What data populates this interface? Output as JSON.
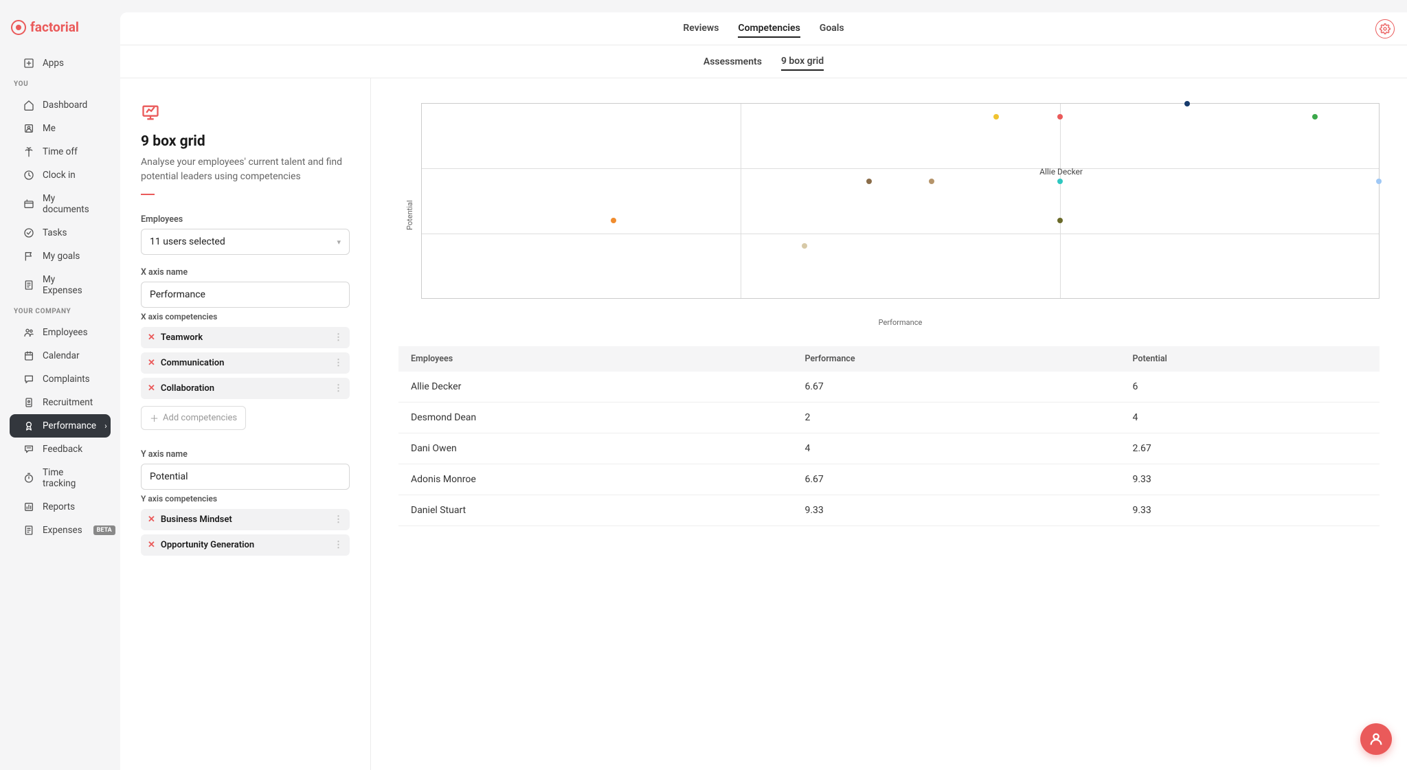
{
  "brand": "factorial",
  "sidebar": {
    "apps": "Apps",
    "you_hdr": "YOU",
    "company_hdr": "YOUR COMPANY",
    "you": [
      {
        "label": "Dashboard",
        "icon": "home"
      },
      {
        "label": "Me",
        "icon": "user"
      },
      {
        "label": "Time off",
        "icon": "palm"
      },
      {
        "label": "Clock in",
        "icon": "clock"
      },
      {
        "label": "My documents",
        "icon": "folder"
      },
      {
        "label": "Tasks",
        "icon": "check"
      },
      {
        "label": "My goals",
        "icon": "flag"
      },
      {
        "label": "My Expenses",
        "icon": "receipt"
      }
    ],
    "company": [
      {
        "label": "Employees",
        "icon": "people"
      },
      {
        "label": "Calendar",
        "icon": "calendar"
      },
      {
        "label": "Complaints",
        "icon": "chat"
      },
      {
        "label": "Recruitment",
        "icon": "badge"
      },
      {
        "label": "Performance",
        "icon": "medal",
        "active": true,
        "chevron": true
      },
      {
        "label": "Feedback",
        "icon": "speech"
      },
      {
        "label": "Time tracking",
        "icon": "timer"
      },
      {
        "label": "Reports",
        "icon": "report"
      },
      {
        "label": "Expenses",
        "icon": "receipt",
        "beta": "BETA"
      }
    ]
  },
  "top_tabs": [
    "Reviews",
    "Competencies",
    "Goals"
  ],
  "top_active": 1,
  "sub_tabs": [
    "Assessments",
    "9 box grid"
  ],
  "sub_active": 1,
  "config": {
    "title": "9 box grid",
    "desc": "Analyse your employees' current talent and find potential leaders using competencies",
    "employees_label": "Employees",
    "employees_value": "11 users selected",
    "x_name_label": "X axis name",
    "x_name_value": "Performance",
    "x_comp_label": "X axis competencies",
    "x_comps": [
      "Teamwork",
      "Communication",
      "Collaboration"
    ],
    "y_name_label": "Y axis name",
    "y_name_value": "Potential",
    "y_comp_label": "Y axis competencies",
    "y_comps": [
      "Business Mindset",
      "Opportunity Generation"
    ],
    "add_comp": "Add competencies"
  },
  "chart_data": {
    "type": "scatter",
    "xlabel": "Performance",
    "ylabel": "Potential",
    "xlim": [
      0,
      10
    ],
    "ylim": [
      0,
      10
    ],
    "series": [
      {
        "name": "Allie Decker",
        "x": 6.67,
        "y": 6,
        "color": "#2ec7c0",
        "label": true
      },
      {
        "name": "Desmond Dean",
        "x": 2,
        "y": 4,
        "color": "#f08c2e"
      },
      {
        "name": "Dani Owen",
        "x": 4,
        "y": 2.67,
        "color": "#d7c9a7"
      },
      {
        "name": "Adonis Monroe",
        "x": 6.67,
        "y": 9.33,
        "color": "#ea5a5a"
      },
      {
        "name": "Daniel Stuart",
        "x": 9.33,
        "y": 9.33,
        "color": "#3ba84a"
      },
      {
        "name": "",
        "x": 6,
        "y": 9.33,
        "color": "#f0c330"
      },
      {
        "name": "",
        "x": 8,
        "y": 10,
        "color": "#163a6c"
      },
      {
        "name": "",
        "x": 4.67,
        "y": 6,
        "color": "#8a6d4a"
      },
      {
        "name": "",
        "x": 5.33,
        "y": 6,
        "color": "#b5946a"
      },
      {
        "name": "",
        "x": 6.67,
        "y": 4,
        "color": "#6a6a2a"
      },
      {
        "name": "",
        "x": 10,
        "y": 6,
        "color": "#9fc8f5"
      }
    ]
  },
  "table": {
    "headers": [
      "Employees",
      "Performance",
      "Potential"
    ],
    "rows": [
      [
        "Allie Decker",
        "6.67",
        "6"
      ],
      [
        "Desmond Dean",
        "2",
        "4"
      ],
      [
        "Dani Owen",
        "4",
        "2.67"
      ],
      [
        "Adonis Monroe",
        "6.67",
        "9.33"
      ],
      [
        "Daniel Stuart",
        "9.33",
        "9.33"
      ]
    ]
  }
}
